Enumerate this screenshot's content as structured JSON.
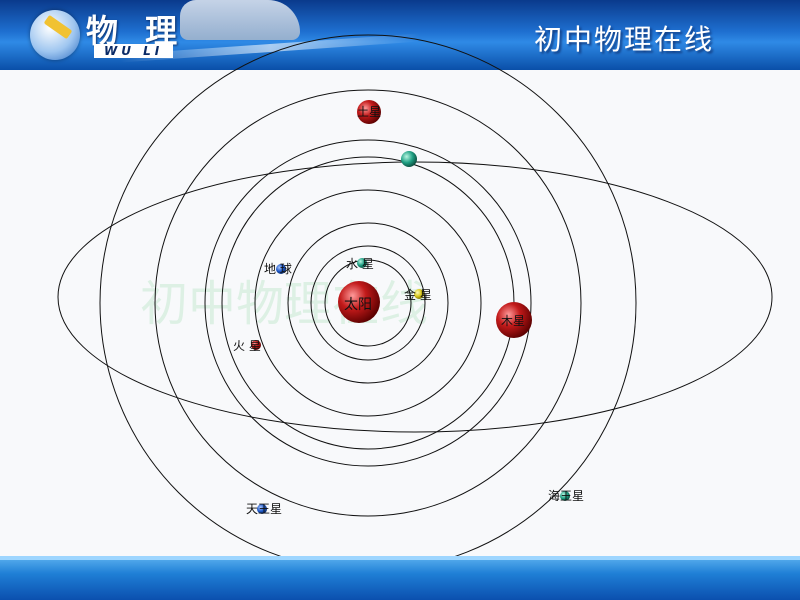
{
  "header": {
    "logo_title": "物 理",
    "logo_sub": "WU LI",
    "site_title": "初中物理在线"
  },
  "watermark": "初中物理在线",
  "diagram": {
    "sun": {
      "label": "太阳",
      "color": "#b51212"
    },
    "planets": [
      {
        "id": "mercury",
        "label": "水 星",
        "color": "#1f9f83"
      },
      {
        "id": "venus",
        "label": "金 星",
        "color": "#d8c81f"
      },
      {
        "id": "earth",
        "label": "地 球",
        "color": "#1d58c8"
      },
      {
        "id": "mars",
        "label": "火 星",
        "color": "#c81e1e"
      },
      {
        "id": "jupiter",
        "label": "木星",
        "color": "#c21a1a"
      },
      {
        "id": "saturn",
        "label": "土星",
        "color": "#c21a1a"
      },
      {
        "id": "green-planet",
        "label": "",
        "color": "#1f9f6b"
      },
      {
        "id": "uranus",
        "label": "天王星",
        "color": "#1d58c8"
      },
      {
        "id": "neptune",
        "label": "海王星",
        "color": "#1f9f83"
      }
    ]
  }
}
